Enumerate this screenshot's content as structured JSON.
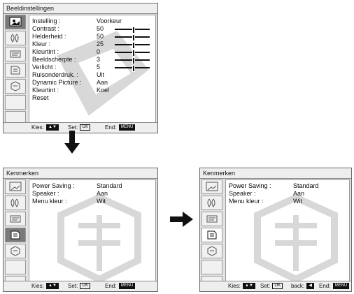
{
  "panel1": {
    "title": "Beeldinstellingen",
    "rows": [
      {
        "label": "Instelling :",
        "value": "Voorkeur"
      },
      {
        "label": "Contrast :",
        "value": "50",
        "level": 0.5
      },
      {
        "label": "Helderheid :",
        "value": "50",
        "level": 0.5
      },
      {
        "label": "Kleur :",
        "value": "25",
        "level": 0.5
      },
      {
        "label": "Kleurtint :",
        "value": "0",
        "level": 0.5
      },
      {
        "label": "Beeldscherpte :",
        "value": "3",
        "level": 0.5
      },
      {
        "label": "Verlicht :",
        "value": "5",
        "level": 0.5
      },
      {
        "label": "Ruisonderdruk. :",
        "value": "Uit"
      },
      {
        "label": "Dynamic Picture :",
        "value": "Aan"
      },
      {
        "label": "Kleurtint :",
        "value": "Koel"
      },
      {
        "label": "Reset",
        "value": ""
      }
    ],
    "footer": {
      "kies": "Kies:",
      "kies_key": "▲▼",
      "set": "Set:",
      "set_key": "OK",
      "end": "End:",
      "end_key": "MENU"
    }
  },
  "panel2": {
    "title": "Kenmerken",
    "rows": [
      {
        "label": "Power Saving :",
        "value": "Standard"
      },
      {
        "label": "Speaker :",
        "value": "Aan"
      },
      {
        "label": "Menu kleur :",
        "value": "Wit"
      }
    ],
    "footer": {
      "kies": "Kies:",
      "kies_key": "▲▼",
      "set": "Set:",
      "set_key": "OK",
      "end": "End:",
      "end_key": "MENU"
    }
  },
  "panel3": {
    "title": "Kenmerken",
    "rows": [
      {
        "label": "Power Saving :",
        "value": "Standard"
      },
      {
        "label": "Speaker :",
        "value": "Aan"
      },
      {
        "label": "Menu kleur :",
        "value": "Wit"
      }
    ],
    "footer": {
      "kies": "Kies:",
      "kies_key": "▲▼",
      "set": "Set:",
      "set_key": "OK",
      "back": "back:",
      "back_key": "◀",
      "end": "End:",
      "end_key": "MENU"
    }
  },
  "tab_icons": [
    "picture-settings-icon",
    "sound-icon",
    "screen-icon",
    "features-icon",
    "setup-icon"
  ],
  "colors": {
    "selected_row": "#9a9a9a",
    "active_tab": "#7a7a7a",
    "panel_bg": "#e2e2e2"
  }
}
